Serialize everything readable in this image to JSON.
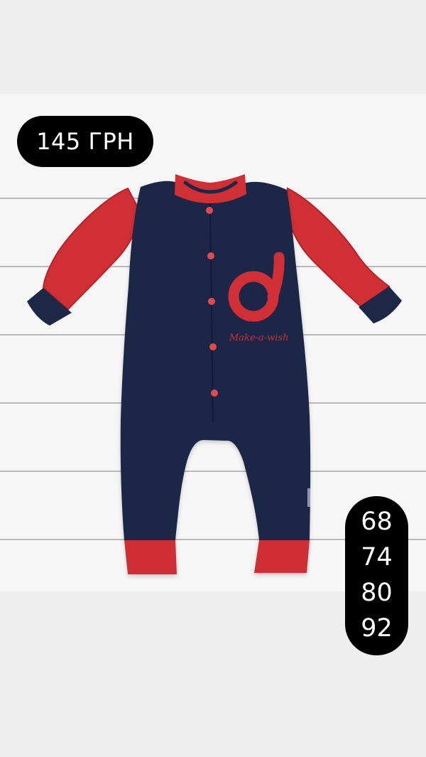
{
  "price": {
    "label": "145 ГРН"
  },
  "sizes": [
    "68",
    "74",
    "80",
    "92"
  ],
  "product": {
    "embroidery_text": "Make-a-wish",
    "colors": {
      "body": "#1f2747",
      "trim": "#cf2f35",
      "snaps": "#e14a50"
    }
  }
}
